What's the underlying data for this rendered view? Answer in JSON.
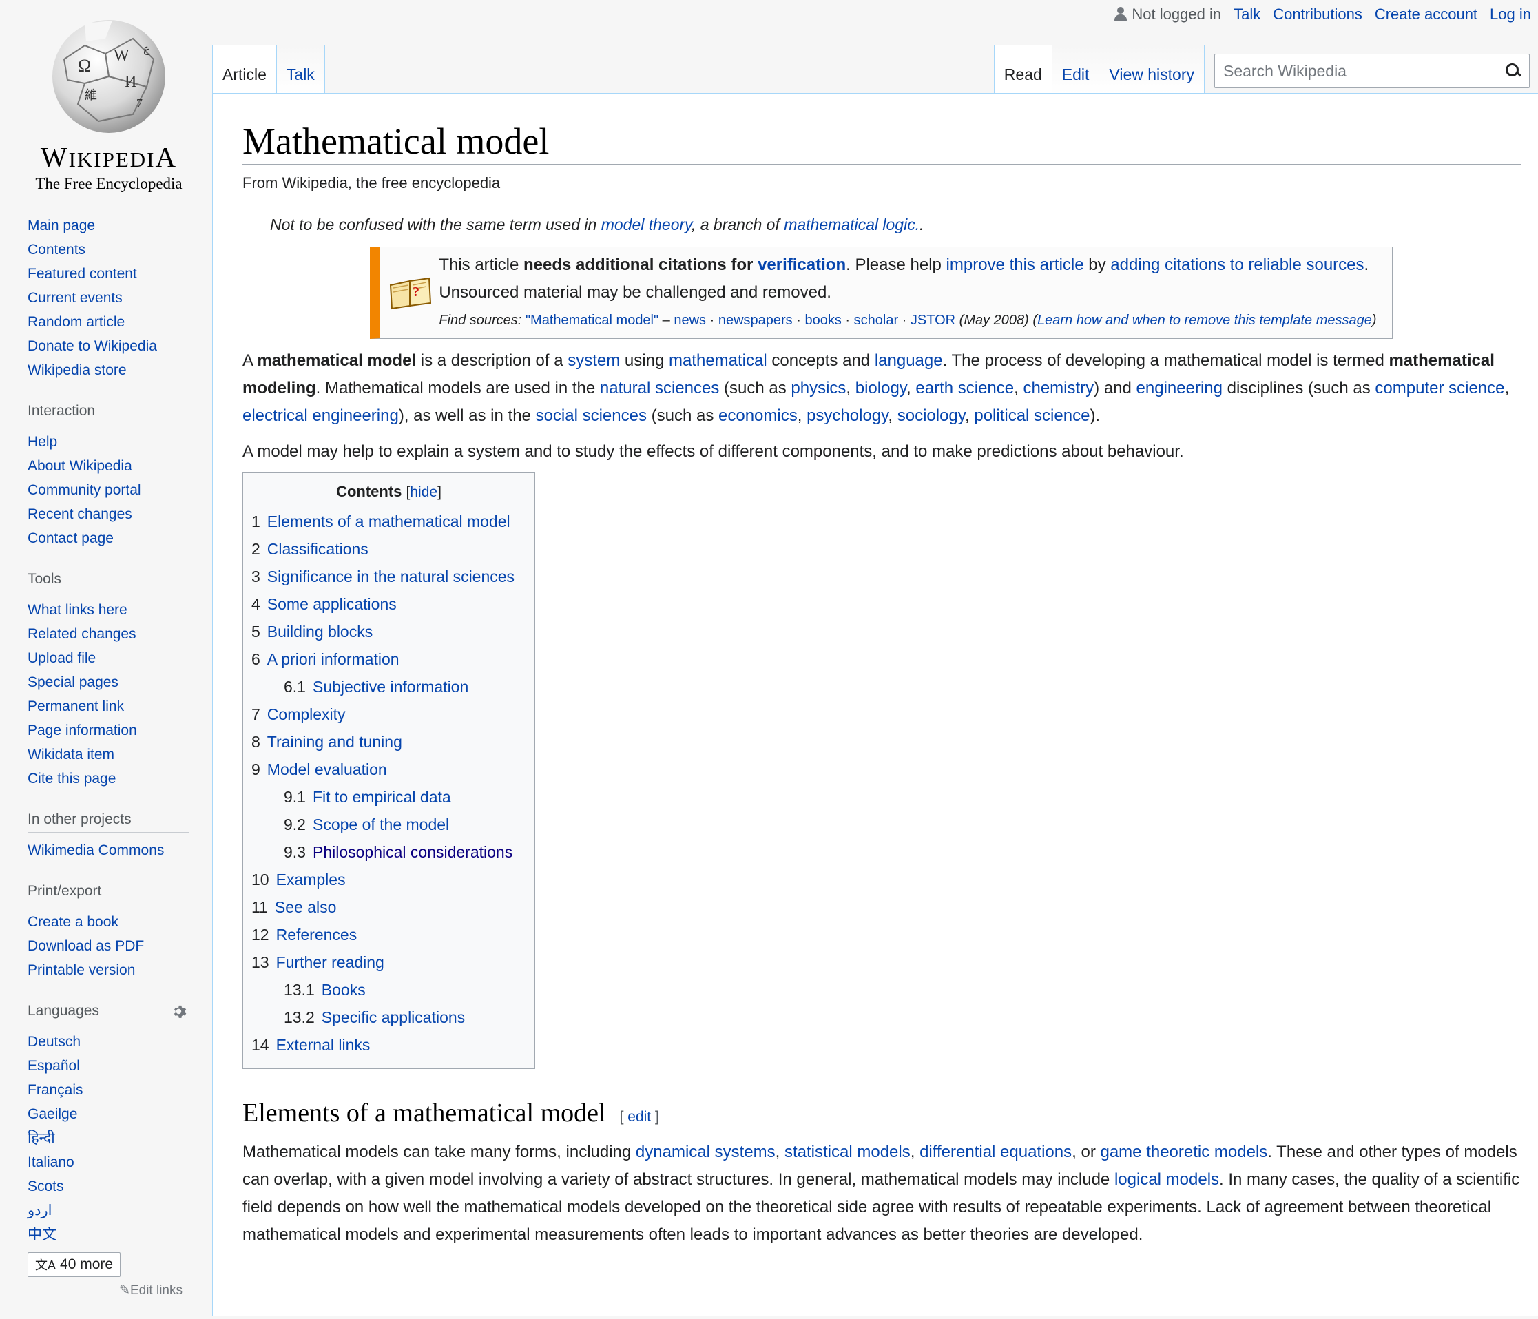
{
  "personal": {
    "not_logged_in": "Not logged in",
    "talk": "Talk",
    "contributions": "Contributions",
    "create_account": "Create account",
    "login": "Log in"
  },
  "logo": {
    "wordmark_first": "W",
    "wordmark_rest": "IKIPEDI",
    "wordmark_last": "A",
    "tagline": "The Free Encyclopedia"
  },
  "sidebar": {
    "navigation": [
      "Main page",
      "Contents",
      "Featured content",
      "Current events",
      "Random article",
      "Donate to Wikipedia",
      "Wikipedia store"
    ],
    "interaction": {
      "heading": "Interaction",
      "items": [
        "Help",
        "About Wikipedia",
        "Community portal",
        "Recent changes",
        "Contact page"
      ]
    },
    "tools": {
      "heading": "Tools",
      "items": [
        "What links here",
        "Related changes",
        "Upload file",
        "Special pages",
        "Permanent link",
        "Page information",
        "Wikidata item",
        "Cite this page"
      ]
    },
    "other_projects": {
      "heading": "In other projects",
      "items": [
        "Wikimedia Commons"
      ]
    },
    "print": {
      "heading": "Print/export",
      "items": [
        "Create a book",
        "Download as PDF",
        "Printable version"
      ]
    },
    "languages": {
      "heading": "Languages",
      "items": [
        "Deutsch",
        "Español",
        "Français",
        "Gaeilge",
        "हिन्दी",
        "Italiano",
        "Scots",
        "اردو",
        "中文"
      ],
      "more": "40 more",
      "edit_links": "Edit links"
    }
  },
  "tabs": {
    "article": "Article",
    "talk": "Talk",
    "read": "Read",
    "edit": "Edit",
    "history": "View history",
    "search_placeholder": "Search Wikipedia"
  },
  "article": {
    "title": "Mathematical model",
    "site_sub": "From Wikipedia, the free encyclopedia",
    "hatnote": {
      "pre": "Not to be confused with the same term used in ",
      "link1": "model theory",
      "mid": ", a branch of ",
      "link2": "mathematical logic.",
      "post": "."
    },
    "ambox": {
      "t1": "This article ",
      "b1": "needs additional citations for ",
      "l1": "verification",
      "t2": ". Please help ",
      "l2": "improve this article",
      "t3": " by ",
      "l3": "adding citations to reliable sources",
      "t4": ". Unsourced material may be challenged and removed.",
      "find": "Find sources:",
      "q": "\"Mathematical model\"",
      "dash": " – ",
      "news": "news",
      "newspapers": "newspapers",
      "books": "books",
      "scholar": "scholar",
      "jstor": "JSTOR",
      "date": "(May 2008)",
      "learn_pre": "(",
      "learn": "Learn how and when to remove this template message",
      "learn_post": ")",
      "dot": " · "
    },
    "intro": {
      "a": "A ",
      "b": "mathematical model",
      "c": " is a description of a ",
      "system": "system",
      "d": " using ",
      "mathematical": "mathematical",
      "e": " concepts and ",
      "language": "language",
      "f": ". The process of developing a mathematical model is termed ",
      "g": "mathematical modeling",
      "h": ". Mathematical models are used in the ",
      "natural_sciences": "natural sciences",
      "i": " (such as ",
      "physics": "physics",
      "comma": ", ",
      "biology": "biology",
      "earth_science": "earth science",
      "chemistry": "chemistry",
      "j": ") and ",
      "engineering": "engineering",
      "k": " disciplines (such as ",
      "computer_science": "computer science",
      "electrical_engineering": "electrical engineering",
      "l": "), as well as in the ",
      "social_sciences": "social sciences",
      "m": " (such as ",
      "economics": "economics",
      "psychology": "psychology",
      "sociology": "sociology",
      "political_science": "political science",
      "n": ")."
    },
    "para2": "A model may help to explain a system and to study the effects of different components, and to make predictions about behaviour.",
    "toc": {
      "title": "Contents",
      "hide_pre": "[",
      "hide": "hide",
      "hide_post": "]",
      "items": [
        {
          "num": "1",
          "label": "Elements of a mathematical model"
        },
        {
          "num": "2",
          "label": "Classifications"
        },
        {
          "num": "3",
          "label": "Significance in the natural sciences"
        },
        {
          "num": "4",
          "label": "Some applications"
        },
        {
          "num": "5",
          "label": "Building blocks"
        },
        {
          "num": "6",
          "label": "A priori information"
        },
        {
          "num": "6.1",
          "label": "Subjective information"
        },
        {
          "num": "7",
          "label": "Complexity"
        },
        {
          "num": "8",
          "label": "Training and tuning"
        },
        {
          "num": "9",
          "label": "Model evaluation"
        },
        {
          "num": "9.1",
          "label": "Fit to empirical data"
        },
        {
          "num": "9.2",
          "label": "Scope of the model"
        },
        {
          "num": "9.3",
          "label": "Philosophical considerations"
        },
        {
          "num": "10",
          "label": "Examples"
        },
        {
          "num": "11",
          "label": "See also"
        },
        {
          "num": "12",
          "label": "References"
        },
        {
          "num": "13",
          "label": "Further reading"
        },
        {
          "num": "13.1",
          "label": "Books"
        },
        {
          "num": "13.2",
          "label": "Specific applications"
        },
        {
          "num": "14",
          "label": "External links"
        }
      ]
    },
    "section1": {
      "heading": "Elements of a mathematical model",
      "edit_pre": "[ ",
      "edit": "edit",
      "edit_post": " ]",
      "a": "Mathematical models can take many forms, including ",
      "dynamical_systems": "dynamical systems",
      "comma": ", ",
      "statistical_models": "statistical models",
      "differential_equations": "differential equations",
      "or": ", or ",
      "game_theoretic_models": "game theoretic models",
      "b": ". These and other types of models can overlap, with a given model involving a variety of abstract structures. In general, mathematical models may include ",
      "logical_models": "logical models",
      "c": ". In many cases, the quality of a scientific field depends on how well the mathematical models developed on the theoretical side agree with results of repeatable experiments. Lack of agreement between theoretical mathematical models and experimental measurements often leads to important advances as better theories are developed."
    }
  }
}
